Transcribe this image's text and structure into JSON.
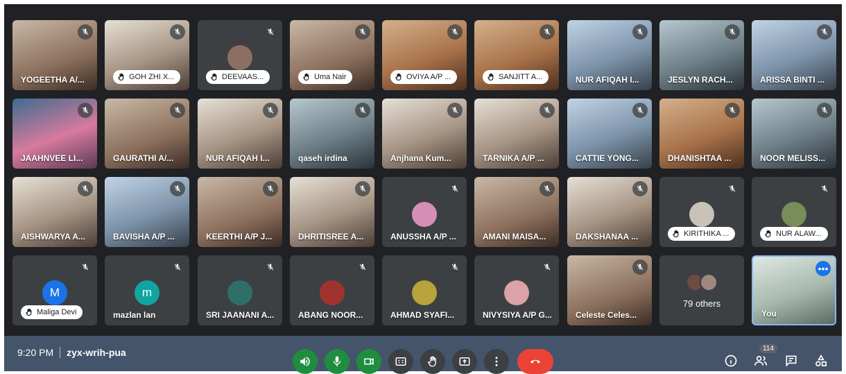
{
  "participants": [
    {
      "name": "YOGEETHA A/...",
      "style": "v1",
      "hand": false
    },
    {
      "name": "GOH ZHI X...",
      "style": "v2",
      "hand": true
    },
    {
      "name": "DEEVAAS...",
      "style": "avatar",
      "hand": true,
      "avatar_color": "#8d6e63"
    },
    {
      "name": "Uma Nair",
      "style": "v1",
      "hand": true
    },
    {
      "name": "OVIYA A/P ...",
      "style": "v5",
      "hand": true
    },
    {
      "name": "SANJITT A...",
      "style": "v5",
      "hand": true
    },
    {
      "name": "NUR AFIQAH I...",
      "style": "v6",
      "hand": false
    },
    {
      "name": "JESLYN RACH...",
      "style": "v4",
      "hand": false
    },
    {
      "name": "ARISSA BINTI ...",
      "style": "v6",
      "hand": false
    },
    {
      "name": "JAAHNVEE LI...",
      "style": "v7",
      "hand": false
    },
    {
      "name": "GAURATHI A/...",
      "style": "v1",
      "hand": false
    },
    {
      "name": "NUR AFIQAH I...",
      "style": "v2",
      "hand": false
    },
    {
      "name": "qaseh irdina",
      "style": "v4",
      "hand": false
    },
    {
      "name": "Anjhana Kum...",
      "style": "v2",
      "hand": false
    },
    {
      "name": "TARNIKA A/P ...",
      "style": "v2",
      "hand": false
    },
    {
      "name": "CATTIE YONG...",
      "style": "v6",
      "hand": false
    },
    {
      "name": "DHANISHTAA ...",
      "style": "v5",
      "hand": false
    },
    {
      "name": "NOOR MELISS...",
      "style": "v4",
      "hand": false
    },
    {
      "name": "AISHWARYA A...",
      "style": "v2",
      "hand": false
    },
    {
      "name": "BAVISHA A/P ...",
      "style": "v6",
      "hand": false
    },
    {
      "name": "KEERTHI A/P J...",
      "style": "v1",
      "hand": false
    },
    {
      "name": "DHRITISREE A...",
      "style": "v2",
      "hand": false
    },
    {
      "name": "ANUSSHA A/P ...",
      "style": "avatar",
      "hand": false,
      "avatar_color": "#d48fb5"
    },
    {
      "name": "AMANI MAISA...",
      "style": "v1",
      "hand": false
    },
    {
      "name": "DAKSHANAA ...",
      "style": "v2",
      "hand": false
    },
    {
      "name": "KIRITHIKA ...",
      "style": "avatar",
      "hand": true,
      "avatar_color": "#c9c2b8"
    },
    {
      "name": "NUR ALAW...",
      "style": "avatar",
      "hand": true,
      "avatar_color": "#7a8c5a"
    },
    {
      "name": "Maliga Devi",
      "style": "letter",
      "hand": true,
      "letter": "M",
      "avatar_color": "#1a73e8"
    },
    {
      "name": "mazlan lan",
      "style": "letter",
      "hand": false,
      "letter": "m",
      "avatar_color": "#12a4a0"
    },
    {
      "name": "SRI JAANANI A...",
      "style": "avatar",
      "hand": false,
      "avatar_color": "#2f6f6a"
    },
    {
      "name": "ABANG NOOR...",
      "style": "avatar",
      "hand": false,
      "avatar_color": "#a1332e"
    },
    {
      "name": "AHMAD SYAFI...",
      "style": "avatar",
      "hand": false,
      "avatar_color": "#b8a23a"
    },
    {
      "name": "NIVYSIYA A/P G...",
      "style": "avatar",
      "hand": false,
      "avatar_color": "#d9a3a8"
    },
    {
      "name": "Celeste Celes...",
      "style": "v1",
      "hand": false
    }
  ],
  "others": {
    "label": "79 others"
  },
  "self_tile": {
    "name": "You",
    "more_icon": "more-dots-icon"
  },
  "meeting": {
    "time": "9:20 PM",
    "code": "zyx-wrih-pua"
  },
  "controls": [
    {
      "name": "speaker-button",
      "icon": "volume-icon",
      "color": "#1e8e3e"
    },
    {
      "name": "microphone-button",
      "icon": "microphone-icon",
      "color": "#1e8e3e"
    },
    {
      "name": "camera-button",
      "icon": "camera-icon",
      "color": "#1e8e3e"
    },
    {
      "name": "captions-button",
      "icon": "captions-icon",
      "color": "#3c4043"
    },
    {
      "name": "raise-hand-button",
      "icon": "hand-icon",
      "color": "#3c4043"
    },
    {
      "name": "present-button",
      "icon": "present-icon",
      "color": "#3c4043"
    },
    {
      "name": "more-options-button",
      "icon": "more-vert-icon",
      "color": "#3c4043"
    },
    {
      "name": "leave-call-button",
      "icon": "phone-hangup-icon",
      "color": "#ea4335"
    }
  ],
  "right_controls": {
    "people_count": "114",
    "icons": [
      "info-icon",
      "people-icon",
      "chat-icon",
      "activities-icon"
    ]
  }
}
